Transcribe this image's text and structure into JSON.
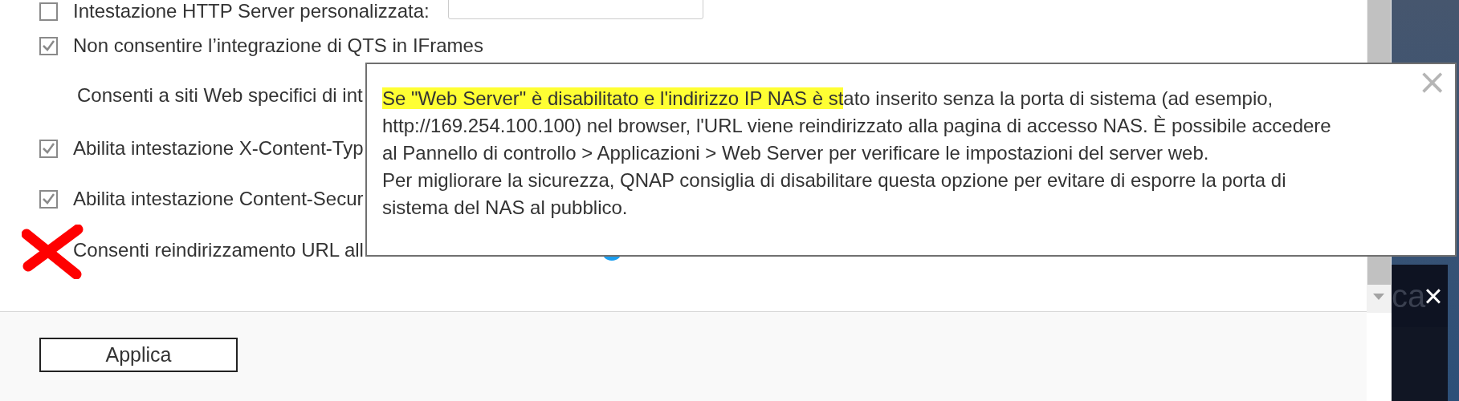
{
  "settings": [
    {
      "kind": "checkbox_field",
      "label": "Intestazione HTTP Server personalizzata:",
      "checked": false
    },
    {
      "kind": "checkbox",
      "label": "Non consentire l’integrazione di QTS in IFrames",
      "checked": true
    },
    {
      "kind": "text",
      "label": "Consenti a siti Web specifici di int"
    },
    {
      "kind": "checkbox",
      "label": "Abilita intestazione X-Content-Typ",
      "checked": true
    },
    {
      "kind": "checkbox",
      "label": "Abilita intestazione Content-Secur",
      "checked": true
    },
    {
      "kind": "info",
      "label": "Consenti reindirizzamento URL all"
    }
  ],
  "tooltip": {
    "highlighted": "Se \"Web Server\" è disabilitato e l'indirizzo IP NAS è st",
    "lines": [
      "ato inserito senza la porta di sistema (ad esempio,",
      "http://169.254.100.100) nel browser, l'URL viene reindirizzato alla pagina di accesso NAS. È possibile accedere",
      "al Pannello di controllo > Applicazioni > Web Server per verificare le impostazioni del server web.",
      "Per migliorare la sicurezza, QNAP consiglia di disabilitare questa opzione per evitare di esporre la porta di",
      "sistema del NAS al pubblico."
    ],
    "close": "×"
  },
  "footer": {
    "button": "Applica"
  },
  "background_window": {
    "title_fragment": "ca",
    "close": "×"
  }
}
